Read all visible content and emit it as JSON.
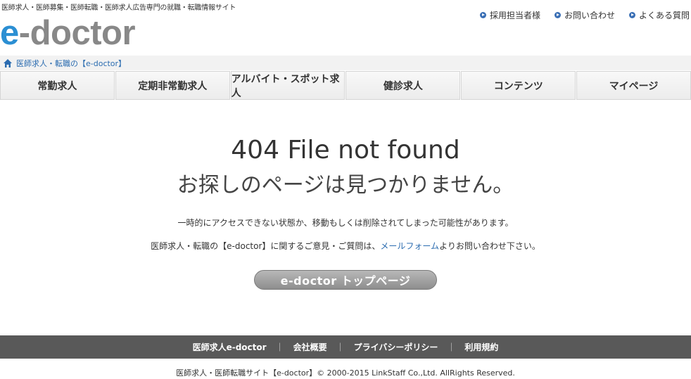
{
  "header": {
    "tagline": "医師求人・医師募集・医師転職・医師求人広告専門の就職・転職情報サイト",
    "logo_e": "e",
    "logo_rest": "-doctor",
    "links": [
      "採用担当者様",
      "お問い合わせ",
      "よくある質問"
    ]
  },
  "breadcrumb": {
    "label": "医師求人・転職の【e-doctor】"
  },
  "nav": {
    "items": [
      "常勤求人",
      "定期非常勤求人",
      "アルバイト・スポット求人",
      "健診求人",
      "コンテンツ",
      "マイページ"
    ]
  },
  "error": {
    "title": "404 File not found",
    "subtitle": "お探しのページは見つかりません。",
    "message1": "一時的にアクセスできない状態か、移動もしくは削除されてしまった可能性があります。",
    "message2_prefix": "医師求人・転職の【e-doctor】に関するご意見・ご質問は、",
    "message2_link": "メールフォーム",
    "message2_suffix": "よりお問い合わせ下さい。",
    "button_label": "e-doctor トップページ"
  },
  "footer": {
    "links": [
      "医師求人e-doctor",
      "会社概要",
      "プライバシーポリシー",
      "利用規約"
    ],
    "separator": "｜",
    "copyright": "医師求人・医師転職サイト【e-doctor】© 2000-2015 LinkStaff Co.,Ltd. AllRights Reserved."
  },
  "colors": {
    "brand_blue": "#2b8fd3",
    "logo_gray": "#888888",
    "link_blue": "#2b6cb0",
    "footer_bg": "#595959"
  }
}
